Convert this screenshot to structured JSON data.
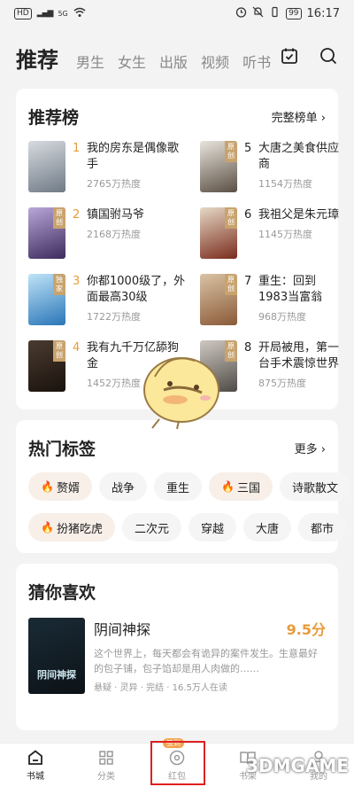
{
  "status": {
    "time": "16:17",
    "battery": "99",
    "hd": "HD",
    "signal": "5G"
  },
  "tabs": [
    "推荐",
    "男生",
    "女生",
    "出版",
    "视频",
    "听书"
  ],
  "rank": {
    "title": "推荐榜",
    "more": "完整榜单",
    "items": [
      {
        "num": "1",
        "title": "我的房东是偶像歌手",
        "heat": "2765万热度",
        "badge": "",
        "color1": "#d7dbe0",
        "color2": "#6f7a86"
      },
      {
        "num": "5",
        "title": "大唐之美食供应商",
        "heat": "1154万热度",
        "badge": "原创",
        "color1": "#e8e4dc",
        "color2": "#5b4f44"
      },
      {
        "num": "2",
        "title": "镇国驸马爷",
        "heat": "2168万热度",
        "badge": "原创",
        "color1": "#b9a6d8",
        "color2": "#3d2b5e"
      },
      {
        "num": "6",
        "title": "我祖父是朱元璋",
        "heat": "1145万热度",
        "badge": "原创",
        "color1": "#e6d8c6",
        "color2": "#7a2c1c"
      },
      {
        "num": "3",
        "title": "你都1000级了，外面最高30级",
        "heat": "1722万热度",
        "badge": "独家",
        "color1": "#bfe3f7",
        "color2": "#2a76b8"
      },
      {
        "num": "7",
        "title": "重生：回到1983当富翁",
        "heat": "968万热度",
        "badge": "原创",
        "color1": "#d9c3a4",
        "color2": "#8a5a38"
      },
      {
        "num": "4",
        "title": "我有九千万亿舔狗金",
        "heat": "1452万热度",
        "badge": "原创",
        "color1": "#4a3b30",
        "color2": "#1a120d"
      },
      {
        "num": "8",
        "title": "开局被甩，第一台手术震惊世界",
        "heat": "875万热度",
        "badge": "原创",
        "color1": "#cfc9c2",
        "color2": "#4e4a45"
      }
    ]
  },
  "tags": {
    "title": "热门标签",
    "more": "更多",
    "row1": [
      {
        "label": "赘婿",
        "hot": true
      },
      {
        "label": "战争",
        "hot": false
      },
      {
        "label": "重生",
        "hot": false
      },
      {
        "label": "三国",
        "hot": true
      },
      {
        "label": "诗歌散文",
        "hot": false
      }
    ],
    "row2": [
      {
        "label": "扮猪吃虎",
        "hot": true
      },
      {
        "label": "二次元",
        "hot": false
      },
      {
        "label": "穿越",
        "hot": false
      },
      {
        "label": "大唐",
        "hot": false
      },
      {
        "label": "都市",
        "hot": false
      }
    ]
  },
  "guess": {
    "title": "猜你喜欢",
    "book": {
      "title": "阴间神探",
      "score": "9.5分",
      "desc": "这个世界上，每天都会有诡异的案件发生。生意最好的包子铺，包子馅却是用人肉做的……",
      "meta": "悬疑 · 灵异 · 完结 · 16.5万人在读",
      "cover_text": "阴间神探"
    }
  },
  "bottom_nav": [
    {
      "label": "书城",
      "active": true
    },
    {
      "label": "分类",
      "active": false
    },
    {
      "label": "红包",
      "active": false,
      "badge": "签到"
    },
    {
      "label": "书架",
      "active": false
    },
    {
      "label": "我的",
      "active": false
    }
  ],
  "watermark": "3DMGAME"
}
